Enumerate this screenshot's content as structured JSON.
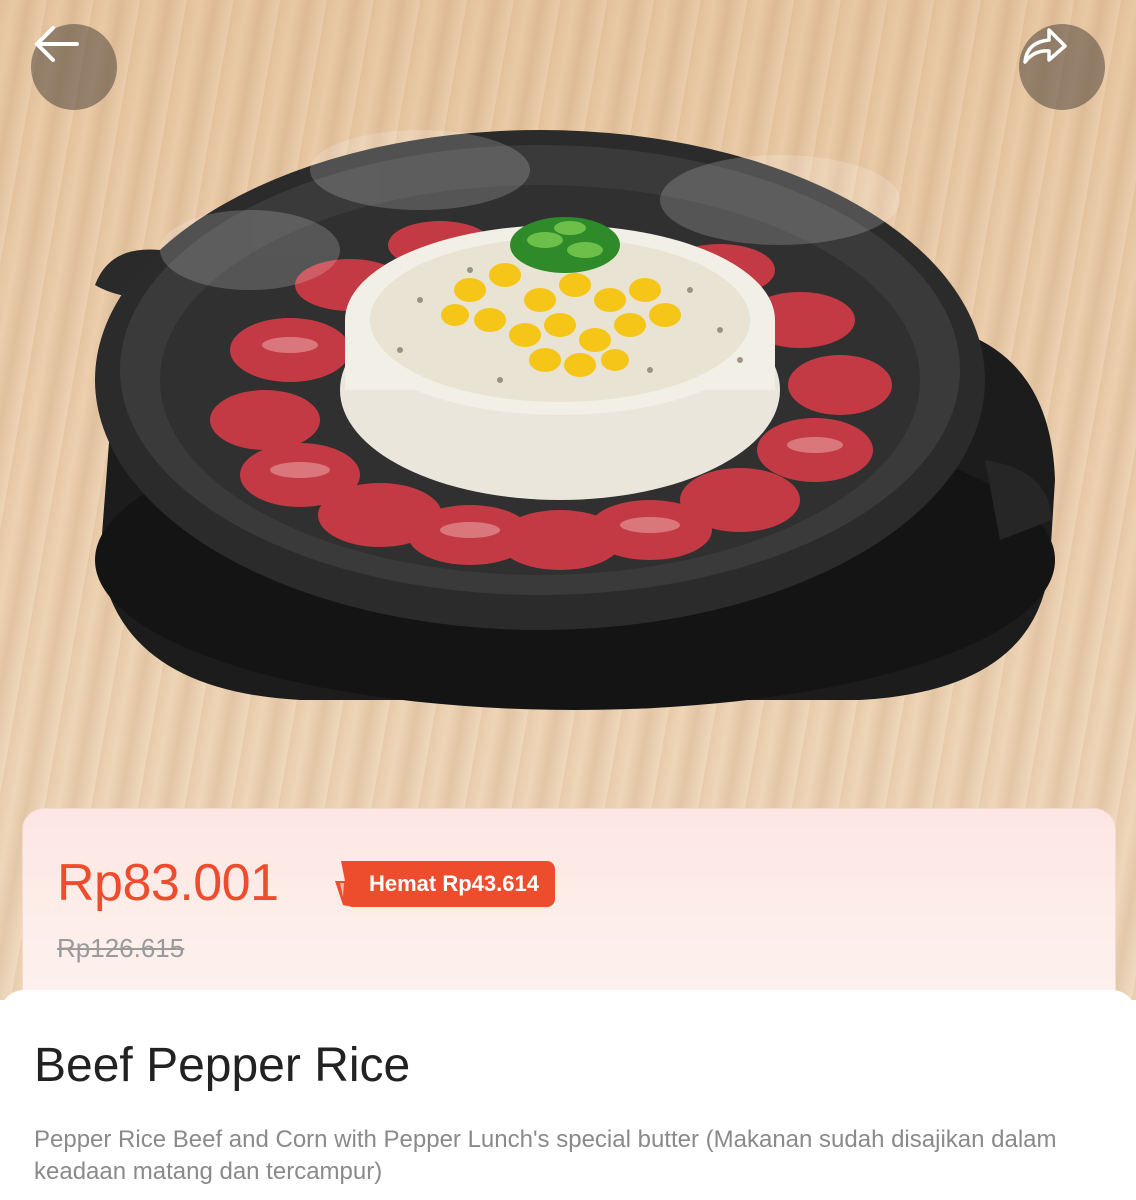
{
  "header": {
    "back_icon": "arrow-left-icon",
    "share_icon": "share-arrow-icon"
  },
  "product": {
    "price_current": "Rp83.001",
    "savings_label": "Hemat Rp43.614",
    "price_original": "Rp126.615",
    "name": "Beef Pepper Rice",
    "description": "Pepper Rice Beef and Corn with Pepper Lunch's special butter (Makanan sudah disajikan dalam keadaan matang dan tercampur)"
  },
  "colors": {
    "accent": "#ee4d2d",
    "text_primary": "#222222",
    "text_secondary": "#8a8a8a"
  }
}
